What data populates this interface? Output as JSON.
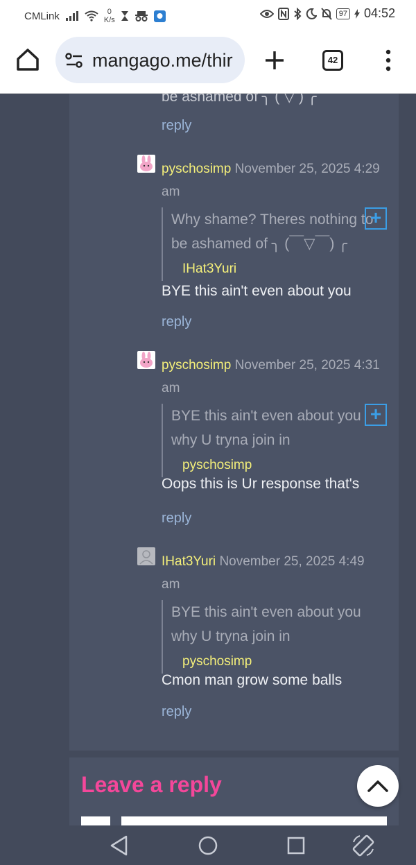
{
  "status_bar": {
    "carrier": "CMLink",
    "net_speed_value": "0",
    "net_speed_unit": "K/s",
    "battery": "97",
    "time": "04:52"
  },
  "browser": {
    "url": "mangago.me/thir",
    "tab_count": "42"
  },
  "page": {
    "prev_quote_tail": "be ashamed of ╮ (  ▽  ) ╭",
    "prev_reply_label": "reply",
    "comments": [
      {
        "username": "pyschosimp",
        "timestamp": "November 25, 2025 4:29 am",
        "quote_text": "Why shame? Theres nothing to be ashamed of ╮ (￣▽￣) ╭",
        "quote_author": "IHat3Yuri",
        "body": "BYE this ain't even about you",
        "reply_label": "reply"
      },
      {
        "username": "pyschosimp",
        "timestamp": "November 25, 2025 4:31 am",
        "quote_text": "BYE this ain't even about you why U tryna join in",
        "quote_author": "pyschosimp",
        "body": "Oops this is Ur response that's",
        "reply_label": "reply"
      },
      {
        "username": "IHat3Yuri",
        "timestamp": "November 25, 2025 4:49 am",
        "quote_text": "BYE this ain't even about you why U tryna join in",
        "quote_author": "pyschosimp",
        "body": "Cmon man grow some balls",
        "reply_label": "reply"
      }
    ],
    "leave_reply_heading": "Leave a reply"
  },
  "colors": {
    "page_bg": "#434a5b",
    "panel_bg": "#4b5366",
    "username": "#f5f07a",
    "reply_link": "#9bb5d8",
    "heading_pink": "#f4479a",
    "quote_plus": "#3b9ee6"
  }
}
